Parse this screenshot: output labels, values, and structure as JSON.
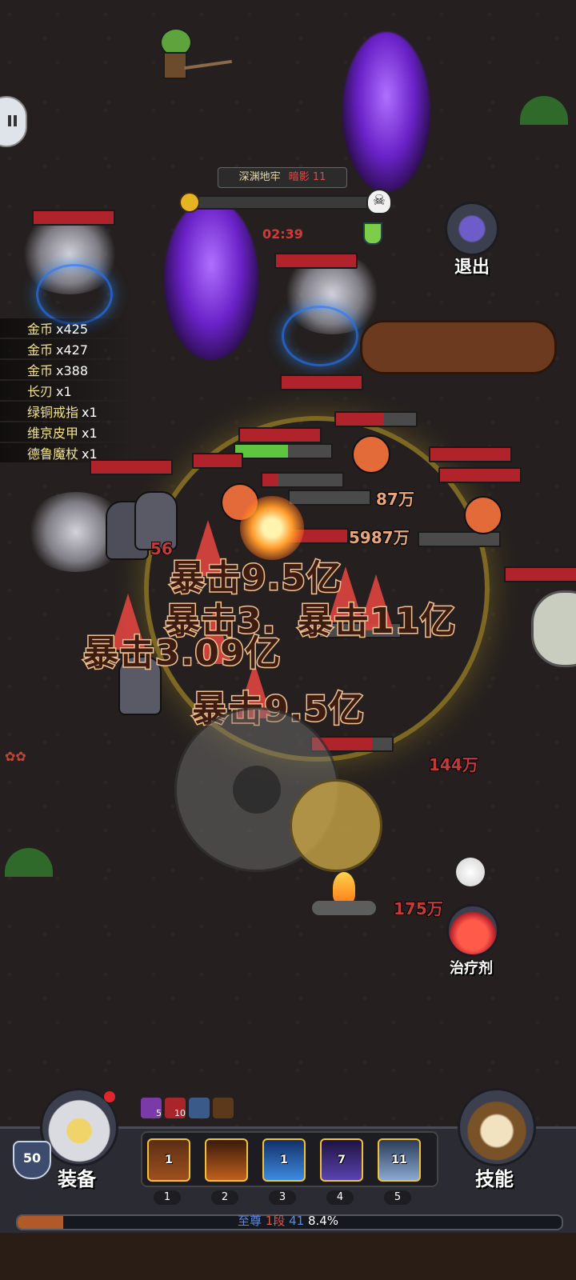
{
  "stage": {
    "name": "深渊地牢",
    "mode": "暗影",
    "level": "11",
    "timer": "02:39",
    "progress": 0.05
  },
  "exit": {
    "label": "退出",
    "icon": "portal-gate-icon"
  },
  "potion": {
    "label": "治疗剂",
    "icon": "red-potion-icon"
  },
  "loot": [
    {
      "name": "金币",
      "count": "x425"
    },
    {
      "name": "金币",
      "count": "x427"
    },
    {
      "name": "金币",
      "count": "x388"
    },
    {
      "name": "长刃",
      "count": "x1"
    },
    {
      "name": "绿铜戒指",
      "count": "x1"
    },
    {
      "name": "维京皮甲",
      "count": "x1"
    },
    {
      "name": "德鲁魔杖",
      "count": "x1"
    }
  ],
  "damage": {
    "crits": [
      "暴击9.5亿",
      "暴击3.",
      "暴击11亿",
      "暴击3.09亿",
      "暴击9.5亿"
    ],
    "numbers": [
      "56",
      "87万",
      "5987万",
      "144万",
      "175万"
    ]
  },
  "player": {
    "level": "50",
    "equip_label": "装备",
    "skills_label": "技能"
  },
  "buffs": [
    {
      "count": "5",
      "color": "#7a3aa8"
    },
    {
      "count": "10",
      "color": "#a8262a"
    },
    {
      "count": "",
      "color": "#3a5a8a"
    },
    {
      "count": "",
      "color": "#5a3a1a"
    }
  ],
  "skills": [
    {
      "slot": "1",
      "level": "1",
      "icon": "fire-slash-icon"
    },
    {
      "slot": "2",
      "level": "",
      "icon": "volcano-icon"
    },
    {
      "slot": "3",
      "level": "1",
      "icon": "ice-crystal-icon"
    },
    {
      "slot": "4",
      "level": "7",
      "icon": "shadow-wolf-icon"
    },
    {
      "slot": "5",
      "level": "11",
      "icon": "lightning-icon"
    }
  ],
  "xp": {
    "rank": "至尊",
    "rank_tier": "1段",
    "tier_level": "41",
    "percent": "8.4%",
    "fill": 0.084
  },
  "colors": {
    "gold": "#f0c23a",
    "hp_red": "#b1232a",
    "hp_green": "#5fc43f",
    "crit_stroke": "#f2c191"
  }
}
